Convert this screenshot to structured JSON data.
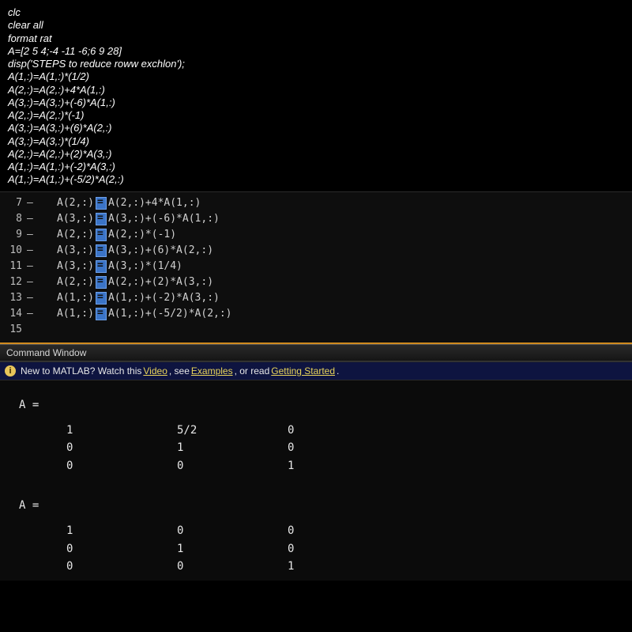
{
  "top": {
    "lines": [
      "clc",
      "clear all",
      "format rat",
      "A=[2 5 4;-4 -11 -6;6 9 28]",
      "disp('STEPS to reduce roww exchlon');",
      "A(1,:)=A(1,:)*(1/2)",
      "A(2,:)=A(2,:)+4*A(1,:)",
      "A(3,:)=A(3,:)+(-6)*A(1,:)",
      "A(2,:)=A(2,:)*(-1)",
      "A(3,:)=A(3,:)+(6)*A(2,:)",
      "A(3,:)=A(3,:)*(1/4)",
      "A(2,:)=A(2,:)+(2)*A(3,:)",
      "A(1,:)=A(1,:)+(-2)*A(3,:)",
      "A(1,:)=A(1,:)+(-5/2)*A(2,:)"
    ]
  },
  "editor": {
    "rows": [
      {
        "n": "7",
        "lhs": "A(2,:)",
        "rhs": "A(2,:)+4*A(1,:)"
      },
      {
        "n": "8",
        "lhs": "A(3,:)",
        "rhs": "A(3,:)+(-6)*A(1,:)"
      },
      {
        "n": "9",
        "lhs": "A(2,:)",
        "rhs": "A(2,:)*(-1)"
      },
      {
        "n": "10",
        "lhs": "A(3,:)",
        "rhs": "A(3,:)+(6)*A(2,:)"
      },
      {
        "n": "11",
        "lhs": "A(3,:)",
        "rhs": "A(3,:)*(1/4)"
      },
      {
        "n": "12",
        "lhs": "A(2,:)",
        "rhs": "A(2,:)+(2)*A(3,:)"
      },
      {
        "n": "13",
        "lhs": "A(1,:)",
        "rhs": "A(1,:)+(-2)*A(3,:)"
      },
      {
        "n": "14",
        "lhs": "A(1,:)",
        "rhs": "A(1,:)+(-5/2)*A(2,:)"
      }
    ],
    "last": "15"
  },
  "cmd": {
    "title": "Command Window",
    "banner_pre": "New to MATLAB? Watch this ",
    "link_video": "Video",
    "banner_mid1": ", see ",
    "link_examples": "Examples",
    "banner_mid2": ", or read ",
    "link_getting": "Getting Started",
    "banner_end": ".",
    "A_label": "A =",
    "mat1": [
      [
        "1",
        "5/2",
        "0"
      ],
      [
        "0",
        "1",
        "0"
      ],
      [
        "0",
        "0",
        "1"
      ]
    ],
    "mat2": [
      [
        "1",
        "0",
        "0"
      ],
      [
        "0",
        "1",
        "0"
      ],
      [
        "0",
        "0",
        "1"
      ]
    ]
  }
}
